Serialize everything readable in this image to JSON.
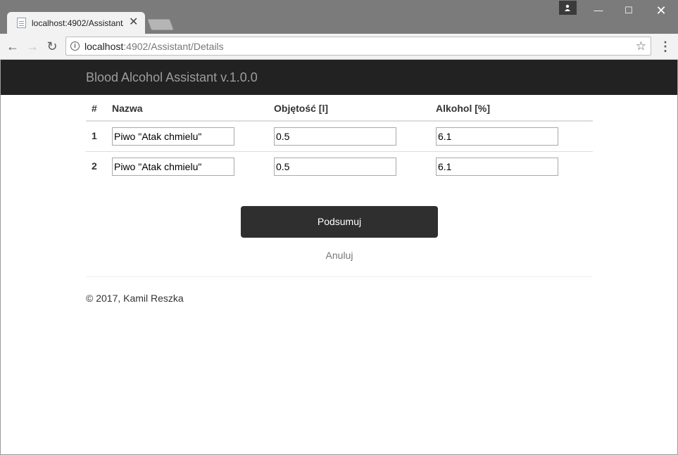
{
  "browser": {
    "tab_title": "localhost:4902/Assistant/",
    "url_host": "localhost",
    "url_path": ":4902/Assistant/Details"
  },
  "icons": {
    "back": "arrow-left-icon",
    "forward": "arrow-right-icon",
    "reload": "reload-icon",
    "info": "info-icon",
    "star": "star-icon",
    "menu": "kebab-menu-icon",
    "close": "close-icon"
  },
  "app": {
    "brand": "Blood Alcohol Assistant v.1.0.0"
  },
  "table": {
    "headers": [
      "#",
      "Nazwa",
      "Objętość [l]",
      "Alkohol [%]"
    ],
    "rows": [
      {
        "num": "1",
        "name": "Piwo \"Atak chmielu\"",
        "volume": "0.5",
        "alcohol": "6.1"
      },
      {
        "num": "2",
        "name": "Piwo \"Atak chmielu\"",
        "volume": "0.5",
        "alcohol": "6.1"
      }
    ]
  },
  "actions": {
    "submit_label": "Podsumuj",
    "cancel_label": "Anuluj"
  },
  "footer": {
    "text": "© 2017, Kamil Reszka"
  },
  "colors": {
    "navbar": "#222222",
    "brand_text": "#9d9d9d",
    "primary_button": "#2f2f2f"
  }
}
